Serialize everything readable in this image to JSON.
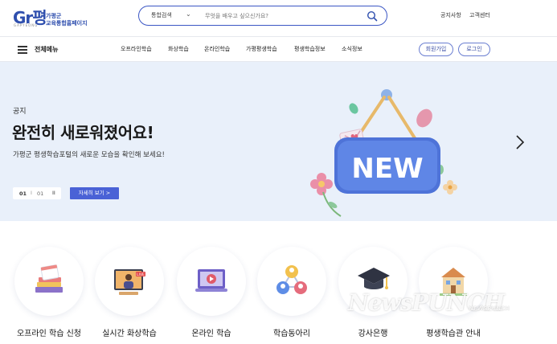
{
  "header": {
    "logo_mark": "Gr평",
    "logo_sub": "GAPYEONG",
    "logo_line1": "가평군",
    "logo_line2": "교육통합홈페이지",
    "search": {
      "category": "통합검색",
      "placeholder": "무엇을 배우고 싶으신가요?"
    },
    "notice_link": "공지사항",
    "customer_link": "고객센터"
  },
  "nav": {
    "all_menu": "전체메뉴",
    "items": [
      "오프라인학습",
      "화상학습",
      "온라인학습",
      "가평평생학습",
      "평생학습정보",
      "소식정보"
    ],
    "signup": "회원가입",
    "login": "로그인"
  },
  "hero": {
    "kicker": "공지",
    "title": "완전히 새로워졌어요!",
    "description": "가평군 평생학습포털의 새로운 모습을 확인해 보세요!",
    "sign_text": "NEW",
    "pager": {
      "current": "01",
      "separator": "I",
      "total": "01",
      "pause": "II"
    },
    "detail_button": "자세히 보기  >"
  },
  "quick_menu": {
    "items": [
      {
        "label": "오프라인 학습 신청",
        "icon": "books-calendar-icon"
      },
      {
        "label": "실시간 화상학습",
        "icon": "live-video-icon"
      },
      {
        "label": "온라인 학습",
        "icon": "laptop-play-icon"
      },
      {
        "label": "학습동아리",
        "icon": "people-group-icon"
      },
      {
        "label": "강사은행",
        "icon": "graduation-cap-icon"
      },
      {
        "label": "평생학습관 안내",
        "icon": "building-icon"
      }
    ]
  },
  "floating": [
    "check-badge-icon",
    "bell-icon",
    "headset-icon"
  ],
  "watermark": {
    "main": "NewsPUNCH",
    "small": "NEWSPUNCH"
  },
  "colors": {
    "accent": "#3b56c4",
    "button": "#4a62d6",
    "hero_bg": "#e9f0fa"
  }
}
